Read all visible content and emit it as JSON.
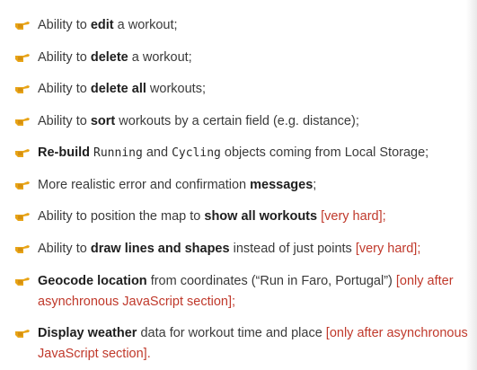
{
  "colors": {
    "icon": "#e8a417",
    "accent_red": "#c0392b",
    "text": "#3a3a3a"
  },
  "icon": "pointing-hand-icon",
  "items": [
    {
      "a": "Ability to ",
      "b": "edit",
      "c": " a workout;"
    },
    {
      "a": "Ability to ",
      "b": "delete",
      "c": " a workout;"
    },
    {
      "a": "Ability to ",
      "b": "delete all",
      "c": " workouts;"
    },
    {
      "a": "Ability to ",
      "b": "sort",
      "c": " workouts by a certain field (e.g. distance);"
    },
    {
      "b": "Re-build",
      "m1": "Running",
      "mid": "and",
      "m2": "Cycling",
      "c": "objects coming from Local Storage;"
    },
    {
      "a": "More realistic error and confirmation ",
      "b": "messages",
      "c": ";"
    },
    {
      "a": "Ability to position the map to ",
      "b": "show all workouts",
      "r": "[very hard];"
    },
    {
      "a": "Ability to ",
      "b": "draw lines and shapes",
      "c": " instead of just points ",
      "r": "[very hard];"
    },
    {
      "b": "Geocode location",
      "c": " from coordinates (“Run in Faro, Portugal”) ",
      "r1": "[only after",
      "r2": "asynchronous JavaScript section];"
    },
    {
      "b": "Display weather",
      "c": " data for workout time and place  ",
      "r1": "[only after asynchronous",
      "r2": "JavaScript section]."
    }
  ]
}
